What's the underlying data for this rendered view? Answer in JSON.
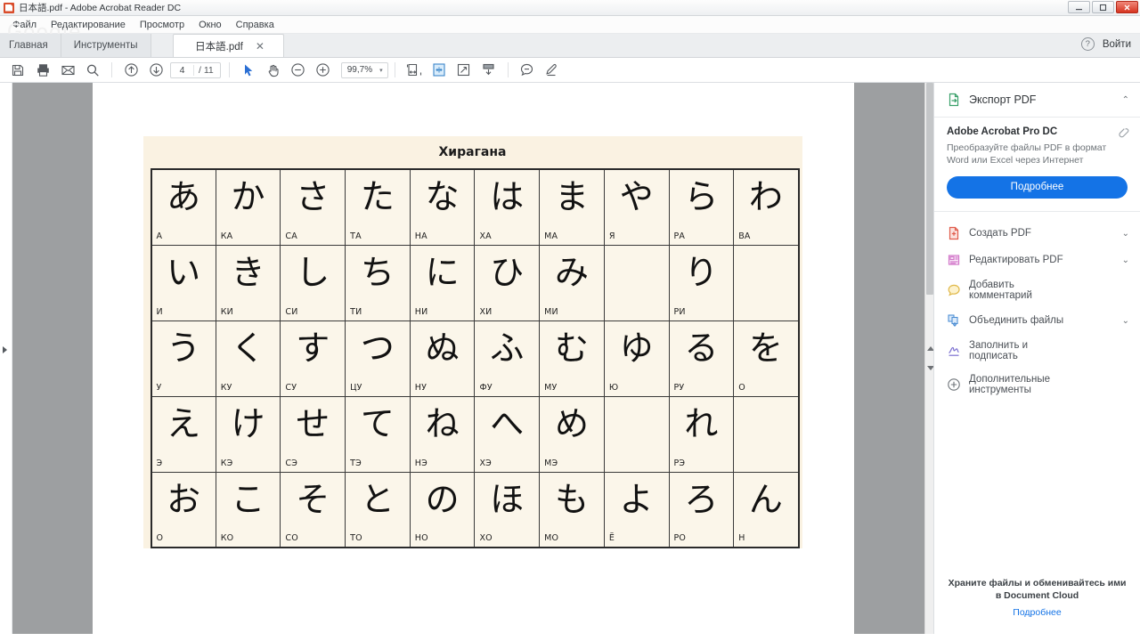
{
  "window": {
    "title": "日本語.pdf - Adobe Acrobat Reader DC",
    "app_icon": "acrobat-icon",
    "minimize": "—",
    "maximize": "❐",
    "close": "✕"
  },
  "menu": {
    "items": [
      "Файл",
      "Редактирование",
      "Просмотр",
      "Окно",
      "Справка"
    ],
    "watermark": "Google"
  },
  "tabs": {
    "home": "Главная",
    "tools": "Инструменты",
    "document": "日本語.pdf",
    "document_close": "✕",
    "help_icon": "?",
    "signin": "Войти"
  },
  "toolbar": {
    "save": "save-icon",
    "print": "print-icon",
    "email": "email-icon",
    "search": "search-icon",
    "prev_page": "arrow-up-icon",
    "next_page": "arrow-down-icon",
    "page_current": "4",
    "page_total": "/ 11",
    "select_tool": "cursor-icon",
    "hand_tool": "hand-icon",
    "zoom_out": "zoom-out-icon",
    "zoom_in": "zoom-in-icon",
    "zoom_value": "99,7%",
    "zoom_caret": "▾",
    "fit_width": "fit-width-icon",
    "fit_page": "fit-page-icon",
    "fullscreen": "fullscreen-icon",
    "scroll_mode": "scroll-mode-icon",
    "comment": "comment-icon",
    "highlight": "highlighter-icon"
  },
  "right_panel": {
    "export": {
      "label": "Экспорт PDF",
      "icon": "export-pdf-icon",
      "caret": "⌃",
      "promo_title": "Adobe Acrobat Pro DC",
      "promo_body": "Преобразуйте файлы PDF в формат Word или Excel через Интернет",
      "promo_button": "Подробнее",
      "pin_icon": "pin-icon"
    },
    "items": [
      {
        "label": "Создать PDF",
        "icon": "create-pdf-icon",
        "caret": "⌄"
      },
      {
        "label": "Редактировать PDF",
        "icon": "edit-pdf-icon",
        "caret": "⌄"
      },
      {
        "label": "Добавить комментарий",
        "icon": "comment-icon",
        "caret": ""
      },
      {
        "label": "Объединить файлы",
        "icon": "combine-files-icon",
        "caret": "⌄"
      },
      {
        "label": "Заполнить и подписать",
        "icon": "fill-sign-icon",
        "caret": ""
      },
      {
        "label": "Дополнительные инструменты",
        "icon": "plus-circle-icon",
        "caret": ""
      }
    ],
    "footer": {
      "text": "Храните файлы и обменивайтесь ими в Document Cloud",
      "link": "Подробнее"
    }
  },
  "document": {
    "title": "Хирагана",
    "background": "#faf2e2",
    "cell_background": "#fbf6ea",
    "rows": [
      [
        {
          "kana": "あ",
          "romaji": "А"
        },
        {
          "kana": "か",
          "romaji": "КА"
        },
        {
          "kana": "さ",
          "romaji": "СА"
        },
        {
          "kana": "た",
          "romaji": "ТА"
        },
        {
          "kana": "な",
          "romaji": "НА"
        },
        {
          "kana": "は",
          "romaji": "ХА"
        },
        {
          "kana": "ま",
          "romaji": "МА"
        },
        {
          "kana": "や",
          "romaji": "Я"
        },
        {
          "kana": "ら",
          "romaji": "РА"
        },
        {
          "kana": "わ",
          "romaji": "ВА"
        }
      ],
      [
        {
          "kana": "い",
          "romaji": "И"
        },
        {
          "kana": "き",
          "romaji": "КИ"
        },
        {
          "kana": "し",
          "romaji": "СИ"
        },
        {
          "kana": "ち",
          "romaji": "ТИ"
        },
        {
          "kana": "に",
          "romaji": "НИ"
        },
        {
          "kana": "ひ",
          "romaji": "ХИ"
        },
        {
          "kana": "み",
          "romaji": "МИ"
        },
        {
          "kana": "",
          "romaji": ""
        },
        {
          "kana": "り",
          "romaji": "РИ"
        },
        {
          "kana": "",
          "romaji": ""
        }
      ],
      [
        {
          "kana": "う",
          "romaji": "У"
        },
        {
          "kana": "く",
          "romaji": "КУ"
        },
        {
          "kana": "す",
          "romaji": "СУ"
        },
        {
          "kana": "つ",
          "romaji": "ЦУ"
        },
        {
          "kana": "ぬ",
          "romaji": "НУ"
        },
        {
          "kana": "ふ",
          "romaji": "ФУ"
        },
        {
          "kana": "む",
          "romaji": "МУ"
        },
        {
          "kana": "ゆ",
          "romaji": "Ю"
        },
        {
          "kana": "る",
          "romaji": "РУ"
        },
        {
          "kana": "を",
          "romaji": "О"
        }
      ],
      [
        {
          "kana": "え",
          "romaji": "Э"
        },
        {
          "kana": "け",
          "romaji": "КЭ"
        },
        {
          "kana": "せ",
          "romaji": "СЭ"
        },
        {
          "kana": "て",
          "romaji": "ТЭ"
        },
        {
          "kana": "ね",
          "romaji": "НЭ"
        },
        {
          "kana": "へ",
          "romaji": "ХЭ"
        },
        {
          "kana": "め",
          "romaji": "МЭ"
        },
        {
          "kana": "",
          "romaji": ""
        },
        {
          "kana": "れ",
          "romaji": "РЭ"
        },
        {
          "kana": "",
          "romaji": ""
        }
      ],
      [
        {
          "kana": "お",
          "romaji": "О"
        },
        {
          "kana": "こ",
          "romaji": "КО"
        },
        {
          "kana": "そ",
          "romaji": "СО"
        },
        {
          "kana": "と",
          "romaji": "ТО"
        },
        {
          "kana": "の",
          "romaji": "НО"
        },
        {
          "kana": "ほ",
          "romaji": "ХО"
        },
        {
          "kana": "も",
          "romaji": "МО"
        },
        {
          "kana": "よ",
          "romaji": "Ё"
        },
        {
          "kana": "ろ",
          "romaji": "РО"
        },
        {
          "kana": "ん",
          "romaji": "Н"
        }
      ]
    ]
  },
  "colors": {
    "accent": "#1473e6",
    "close_button": "#d6331f",
    "viewer_bg": "#9d9fa1"
  }
}
